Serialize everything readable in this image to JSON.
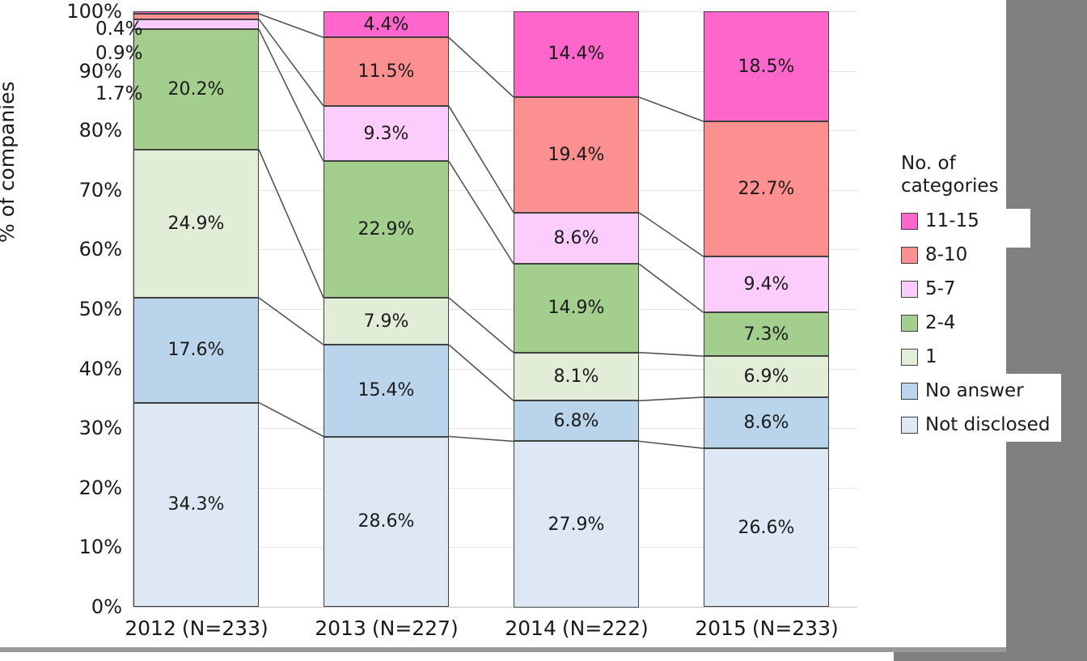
{
  "chart_data": {
    "type": "bar",
    "subtype": "stacked-100-percent",
    "title": "",
    "xlabel": "",
    "ylabel": "% of companies",
    "ylim": [
      0,
      100
    ],
    "ytick_labels": [
      "0%",
      "10%",
      "20%",
      "30%",
      "40%",
      "50%",
      "60%",
      "70%",
      "80%",
      "90%",
      "100%"
    ],
    "ytick_values": [
      0,
      10,
      20,
      30,
      40,
      50,
      60,
      70,
      80,
      90,
      100
    ],
    "grid": true,
    "legend_position": "right",
    "legend_title": "No. of categories",
    "categories": [
      "2012",
      "2013",
      "2014",
      "2015"
    ],
    "category_counts": [
      "(N=233)",
      "(N=227)",
      "(N=222)",
      "(N=233)"
    ],
    "stack_order_bottom_to_top": [
      "Not disclosed",
      "No answer",
      "1",
      "2-4",
      "5-7",
      "8-10",
      "11-15"
    ],
    "series": [
      {
        "name": "11-15",
        "color": "#FF66CC",
        "values": [
          0.4,
          4.4,
          14.4,
          18.5
        ]
      },
      {
        "name": "8-10",
        "color": "#FC9090",
        "values": [
          0.9,
          11.5,
          19.4,
          22.7
        ]
      },
      {
        "name": "5-7",
        "color": "#FCCDFC",
        "values": [
          1.7,
          9.3,
          8.6,
          9.4
        ]
      },
      {
        "name": "2-4",
        "color": "#A4CE8D",
        "values": [
          20.2,
          22.9,
          14.9,
          7.3
        ]
      },
      {
        "name": "1",
        "color": "#E2EDD8",
        "values": [
          24.9,
          7.9,
          8.1,
          6.9
        ]
      },
      {
        "name": "No answer",
        "color": "#BAD4EB",
        "values": [
          17.6,
          15.4,
          6.8,
          8.6
        ]
      },
      {
        "name": "Not disclosed",
        "color": "#DEE8F4",
        "values": [
          34.3,
          28.6,
          27.9,
          26.6
        ]
      }
    ],
    "value_labels": {
      "2012": [
        "0.4%",
        "0.9%",
        "1.7%",
        "20.2%",
        "24.9%",
        "17.6%",
        "34.3%"
      ],
      "2013": [
        "4.4%",
        "11.5%",
        "9.3%",
        "22.9%",
        "7.9%",
        "15.4%",
        "28.6%"
      ],
      "2014": [
        "14.4%",
        "19.4%",
        "8.6%",
        "14.9%",
        "8.1%",
        "6.8%",
        "27.9%"
      ],
      "2015": [
        "18.5%",
        "22.7%",
        "9.4%",
        "7.3%",
        "6.9%",
        "8.6%",
        "26.6%"
      ]
    }
  },
  "yaxis": {
    "title": "% of companies",
    "ticks": [
      {
        "label": "100%",
        "value": 100
      },
      {
        "label": "90%",
        "value": 90
      },
      {
        "label": "80%",
        "value": 80
      },
      {
        "label": "70%",
        "value": 70
      },
      {
        "label": "60%",
        "value": 60
      },
      {
        "label": "50%",
        "value": 50
      },
      {
        "label": "40%",
        "value": 40
      },
      {
        "label": "30%",
        "value": 30
      },
      {
        "label": "20%",
        "value": 20
      },
      {
        "label": "10%",
        "value": 10
      },
      {
        "label": "0%",
        "value": 0
      }
    ]
  },
  "xaxis": {
    "groups": [
      {
        "year": "2012",
        "n": "(N=233)"
      },
      {
        "year": "2013",
        "n": "(N=227)"
      },
      {
        "year": "2014",
        "n": "(N=222)"
      },
      {
        "year": "2015",
        "n": "(N=233)"
      }
    ]
  },
  "legend": {
    "title_line1": "No. of",
    "title_line2": "categories",
    "items": [
      {
        "label": "11-15",
        "color": "#FF66CC"
      },
      {
        "label": "8-10",
        "color": "#FC9090"
      },
      {
        "label": "5-7",
        "color": "#FCCDFC"
      },
      {
        "label": "2-4",
        "color": "#A4CE8D"
      },
      {
        "label": "1",
        "color": "#E2EDD8"
      },
      {
        "label": "No answer",
        "color": "#BAD4EB"
      },
      {
        "label": "Not disclosed",
        "color": "#DEE8F4"
      }
    ]
  },
  "external_labels_2012": [
    {
      "text": "0.4%",
      "value": 0.4
    },
    {
      "text": "0.9%",
      "value": 0.9
    },
    {
      "text": "1.7%",
      "value": 1.7
    }
  ]
}
